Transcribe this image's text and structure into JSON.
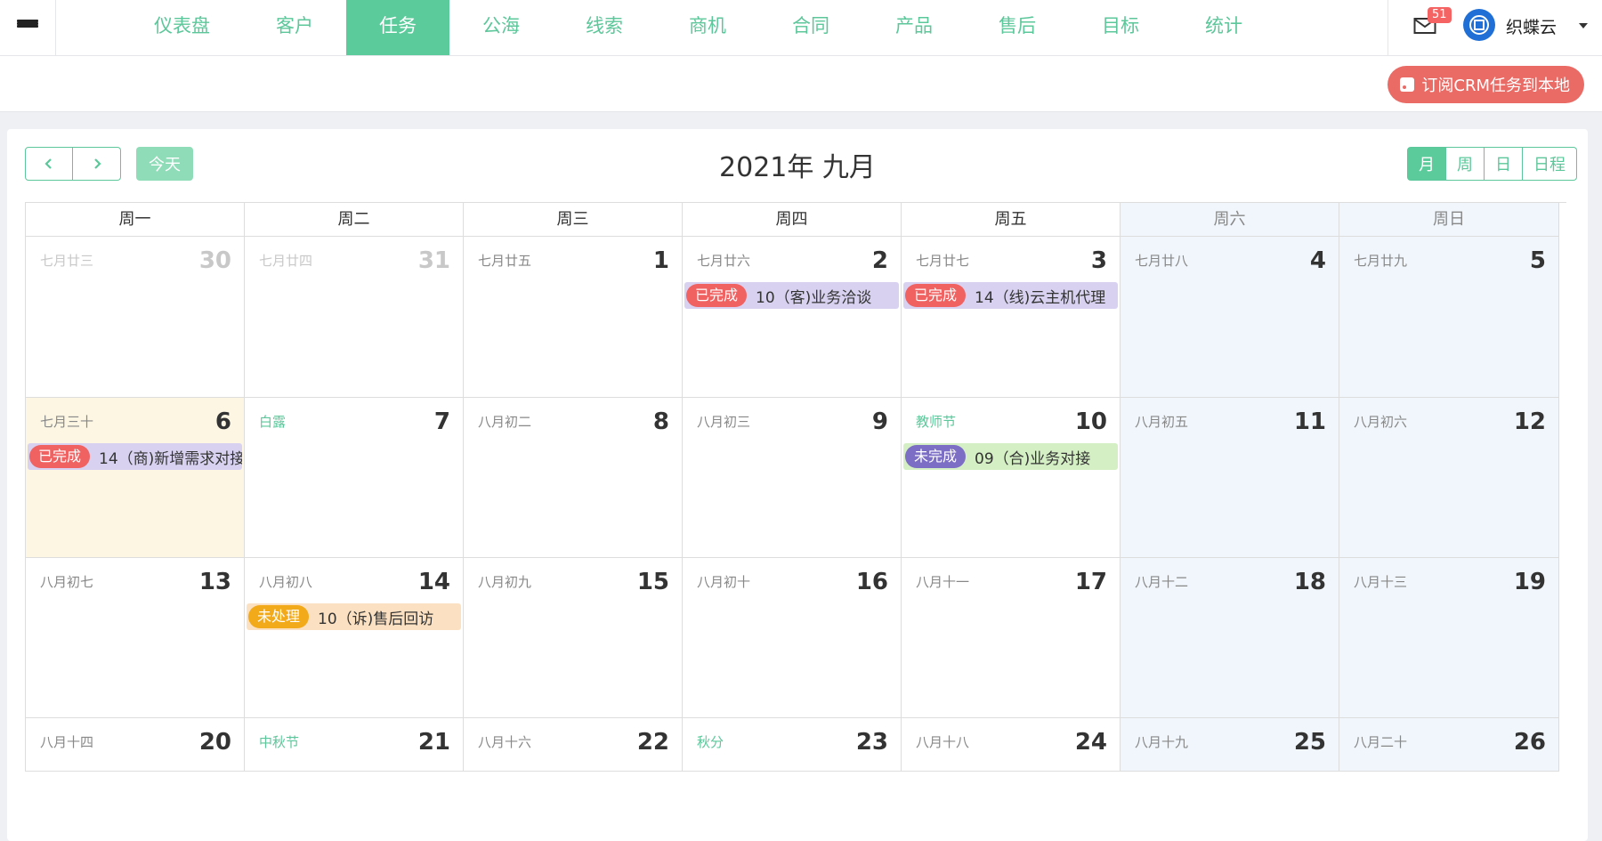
{
  "nav": {
    "items": [
      {
        "label": "仪表盘",
        "active": false
      },
      {
        "label": "客户",
        "active": false
      },
      {
        "label": "任务",
        "active": true
      },
      {
        "label": "公海",
        "active": false
      },
      {
        "label": "线索",
        "active": false
      },
      {
        "label": "商机",
        "active": false
      },
      {
        "label": "合同",
        "active": false
      },
      {
        "label": "产品",
        "active": false
      },
      {
        "label": "售后",
        "active": false
      },
      {
        "label": "目标",
        "active": false
      },
      {
        "label": "统计",
        "active": false
      }
    ]
  },
  "user": {
    "mail_count": "51",
    "name": "织蝶云"
  },
  "subscribe_label": "订阅CRM任务到本地",
  "calendar": {
    "title": "2021年 九月",
    "today_label": "今天",
    "views": [
      {
        "label": "月",
        "active": true
      },
      {
        "label": "周",
        "active": false
      },
      {
        "label": "日",
        "active": false
      },
      {
        "label": "日程",
        "active": false
      }
    ],
    "weekdays": [
      "周一",
      "周二",
      "周三",
      "周四",
      "周五",
      "周六",
      "周日"
    ],
    "weeks": [
      [
        {
          "day": "30",
          "lunar": "七月廿三",
          "other": true
        },
        {
          "day": "31",
          "lunar": "七月廿四",
          "other": true
        },
        {
          "day": "1",
          "lunar": "七月廿五"
        },
        {
          "day": "2",
          "lunar": "七月廿六",
          "event": {
            "status": "已完成",
            "status_color": "#f06161",
            "text": "10（客)业务洽谈",
            "bg": "#d8d2f0"
          }
        },
        {
          "day": "3",
          "lunar": "七月廿七",
          "event": {
            "status": "已完成",
            "status_color": "#f06161",
            "text": "14（线)云主机代理",
            "bg": "#d8d2f0"
          }
        },
        {
          "day": "4",
          "lunar": "七月廿八"
        },
        {
          "day": "5",
          "lunar": "七月廿九"
        }
      ],
      [
        {
          "day": "6",
          "lunar": "七月三十",
          "today": true,
          "event": {
            "status": "已完成",
            "status_color": "#f06161",
            "text": "14（商)新增需求对接",
            "bg": "#d8d2f0"
          }
        },
        {
          "day": "7",
          "lunar": "白露",
          "holiday": true
        },
        {
          "day": "8",
          "lunar": "八月初二"
        },
        {
          "day": "9",
          "lunar": "八月初三"
        },
        {
          "day": "10",
          "lunar": "教师节",
          "holiday": true,
          "event": {
            "status": "未完成",
            "status_color": "#7b6ec4",
            "text": "09（合)业务对接",
            "bg": "#d5efc5"
          }
        },
        {
          "day": "11",
          "lunar": "八月初五"
        },
        {
          "day": "12",
          "lunar": "八月初六"
        }
      ],
      [
        {
          "day": "13",
          "lunar": "八月初七"
        },
        {
          "day": "14",
          "lunar": "八月初八",
          "event": {
            "status": "未处理",
            "status_color": "#f2a91a",
            "text": "10（诉)售后回访",
            "bg": "#fbe1c2"
          }
        },
        {
          "day": "15",
          "lunar": "八月初九"
        },
        {
          "day": "16",
          "lunar": "八月初十"
        },
        {
          "day": "17",
          "lunar": "八月十一"
        },
        {
          "day": "18",
          "lunar": "八月十二"
        },
        {
          "day": "19",
          "lunar": "八月十三"
        }
      ],
      [
        {
          "day": "20",
          "lunar": "八月十四"
        },
        {
          "day": "21",
          "lunar": "中秋节",
          "holiday": true
        },
        {
          "day": "22",
          "lunar": "八月十六"
        },
        {
          "day": "23",
          "lunar": "秋分",
          "holiday": true
        },
        {
          "day": "24",
          "lunar": "八月十八"
        },
        {
          "day": "25",
          "lunar": "八月十九"
        },
        {
          "day": "26",
          "lunar": "八月二十"
        }
      ]
    ]
  }
}
